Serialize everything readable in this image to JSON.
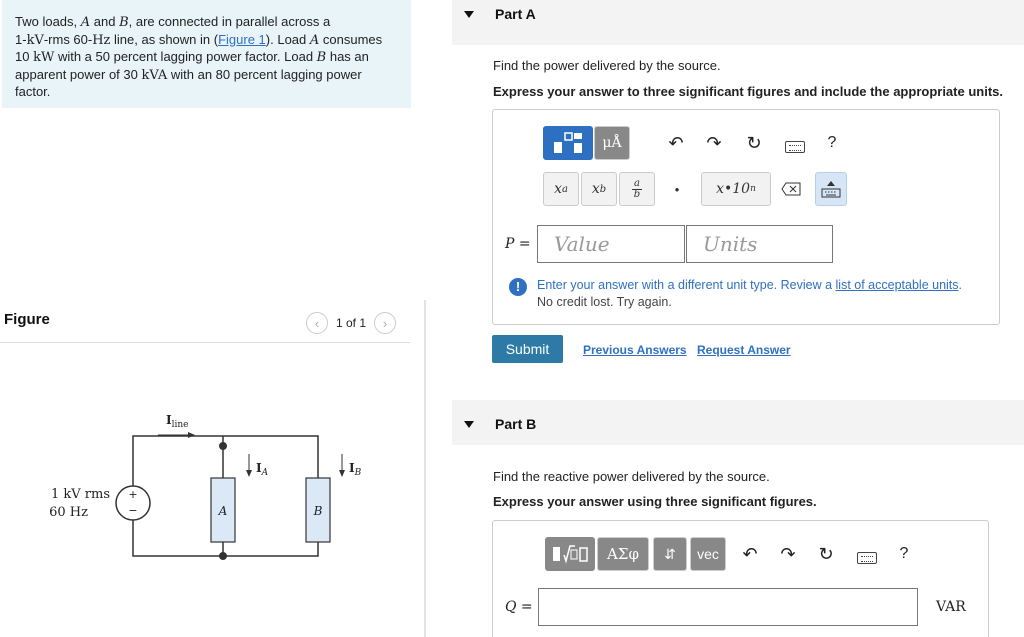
{
  "problem": {
    "line1_pre": "Two loads, ",
    "load_a": "A",
    "line1_and": " and ",
    "load_b": "B",
    "line1_post": ", are connected in parallel across a",
    "line2_pre": "1-",
    "kv": "kV",
    "line2_rms": "-rms 60-",
    "hz": "Hz",
    "line2_mid": " line, as shown in (",
    "figure_link": "Figure 1",
    "line2_post": "). Load ",
    "line2_consumes": " consumes",
    "line3_val": "10 ",
    "kw": "kW",
    "line3_mid": " with a 50 percent lagging power factor. Load ",
    "line3_post": " has an",
    "line4_pre": "apparent power of 30 ",
    "kva": "kVA",
    "line4_post": " with an 80 percent lagging power",
    "line5": "factor."
  },
  "figure": {
    "title": "Figure",
    "counter": "1 of 1",
    "prev_icon": "chevron-left-icon",
    "next_icon": "chevron-right-icon",
    "source_label_1": "1 kV rms",
    "source_label_2": "60 Hz",
    "iline_label": "I",
    "iline_sub": "line",
    "ia_label": "I",
    "ia_sub": "A",
    "ib_label": "I",
    "ib_sub": "B",
    "box_a": "A",
    "box_b": "B",
    "plus": "+",
    "minus": "−"
  },
  "part_a": {
    "title": "Part A",
    "prompt": "Find the power delivered by the source.",
    "instruction": "Express your answer to three significant figures and include the appropriate units.",
    "toolbar": {
      "templates_icon": "templates-icon",
      "units_btn": "μÅ",
      "undo_icon": "undo-icon",
      "redo_icon": "redo-icon",
      "reset_icon": "reset-icon",
      "keyboard_icon": "keyboard-icon",
      "help": "?",
      "superscript": "x",
      "superscript_sup": "a",
      "subscript": "x",
      "subscript_sub": "b",
      "frac_num": "a",
      "frac_den": "b",
      "dot": "•",
      "sci": "x•10",
      "sci_sup": "n",
      "delete_icon": "delete-icon",
      "keyboard_toggle_icon": "keyboard-toggle-icon"
    },
    "var_label": "P =",
    "value_placeholder": "Value",
    "units_placeholder": "Units",
    "error_line1": "Enter your answer with a different unit type. Review a ",
    "error_link": "list of acceptable units",
    "error_line1_end": ".",
    "error_line2": "No credit lost. Try again.",
    "submit": "Submit",
    "previous_answers": "Previous Answers",
    "request_answer": "Request Answer"
  },
  "part_b": {
    "title": "Part B",
    "prompt": "Find the reactive power delivered by the source.",
    "instruction": "Express your answer using three significant figures.",
    "toolbar": {
      "templates_icon": "templates-icon",
      "greek": "ΑΣφ",
      "arrows": "⇵",
      "vec": "vec",
      "undo_icon": "undo-icon",
      "redo_icon": "redo-icon",
      "reset_icon": "reset-icon",
      "keyboard_icon": "keyboard-icon",
      "help": "?"
    },
    "var_label": "Q =",
    "unit": "VAR"
  }
}
